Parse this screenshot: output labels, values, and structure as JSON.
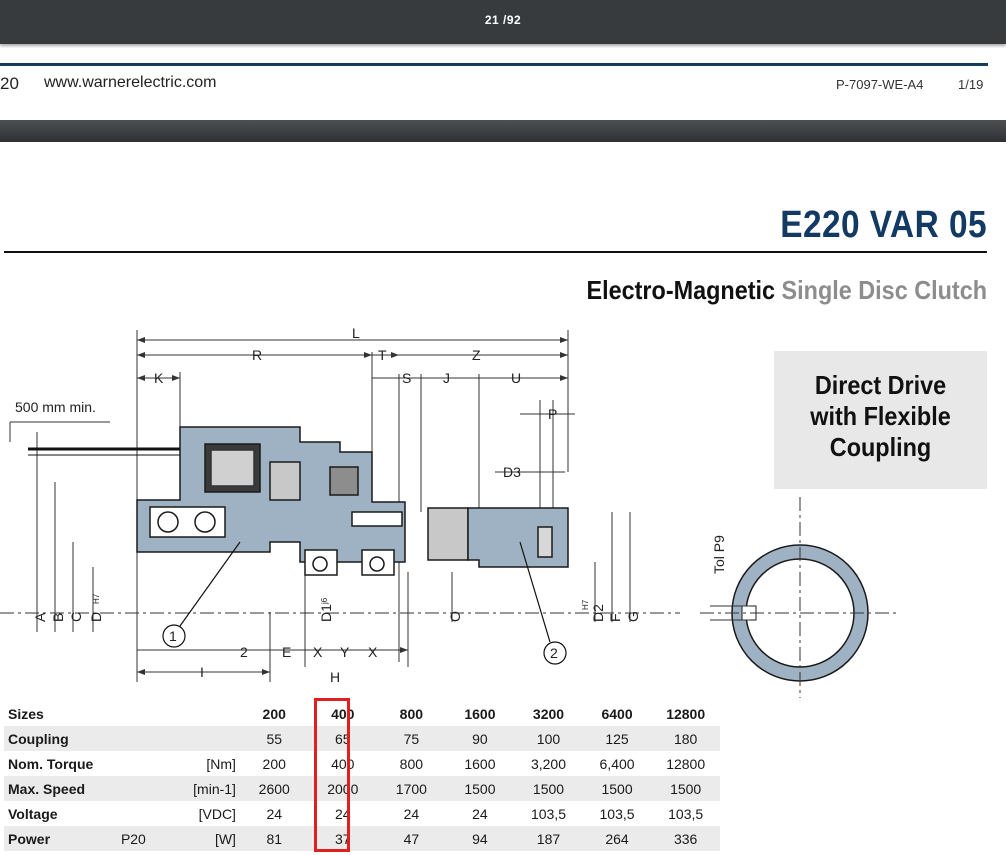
{
  "viewer": {
    "page_indicator": "21 /92"
  },
  "previous_page": {
    "page_number": "20",
    "url": "www.warnerelectric.com",
    "doc_code": "P-7097-WE-A4",
    "doc_page": "1/19"
  },
  "header": {
    "product_title": "E220 VAR 05",
    "subtitle_dark": "Electro-Magnetic",
    "subtitle_light": "Single Disc Clutch"
  },
  "drive_box": {
    "lines": [
      "Direct Drive",
      "with Flexible",
      "Coupling"
    ]
  },
  "drawing": {
    "cable_note": "500 mm min.",
    "dims": {
      "L": "L",
      "R": "R",
      "T": "T",
      "Z": "Z",
      "K": "K",
      "S": "S",
      "J": "J",
      "U": "U",
      "P": "P",
      "D3": "D3",
      "I": "I",
      "H": "H",
      "two": "2",
      "E": "E",
      "X": "X",
      "Y": "Y",
      "A": "A",
      "B": "B",
      "C": "C",
      "D": "D",
      "H7": "H7",
      "D1": "D1",
      "j6": "j6",
      "D2": "D2",
      "F": "F",
      "G": "G",
      "O": "O",
      "tol": "Tol P9"
    },
    "callouts": [
      "1",
      "2"
    ]
  },
  "table": {
    "header": {
      "label": "Sizes",
      "sizes": [
        "200",
        "400",
        "800",
        "1600",
        "3200",
        "6400",
        "12800"
      ]
    },
    "rows": [
      {
        "label": "Coupling",
        "sub": "",
        "unit": "",
        "values": [
          "55",
          "65",
          "75",
          "90",
          "100",
          "125",
          "180"
        ]
      },
      {
        "label": "Nom. Torque",
        "sub": "",
        "unit": "[Nm]",
        "values": [
          "200",
          "400",
          "800",
          "1600",
          "3,200",
          "6,400",
          "12800"
        ]
      },
      {
        "label": "Max. Speed",
        "sub": "",
        "unit": "[min-1]",
        "values": [
          "2600",
          "2000",
          "1700",
          "1500",
          "1500",
          "1500",
          "1500"
        ]
      },
      {
        "label": "Voltage",
        "sub": "",
        "unit": "[VDC]",
        "values": [
          "24",
          "24",
          "24",
          "24",
          "103,5",
          "103,5",
          "103,5"
        ]
      },
      {
        "label": "Power",
        "sub": "P20",
        "unit": "[W]",
        "values": [
          "81",
          "37",
          "47",
          "94",
          "187",
          "264",
          "336"
        ]
      }
    ],
    "highlighted_size": "400",
    "highlight_color": "#e0201e"
  },
  "colors": {
    "brand_blue": "#123a63",
    "part_fill": "#9fb2c4",
    "toolbar": "#383b3e"
  }
}
